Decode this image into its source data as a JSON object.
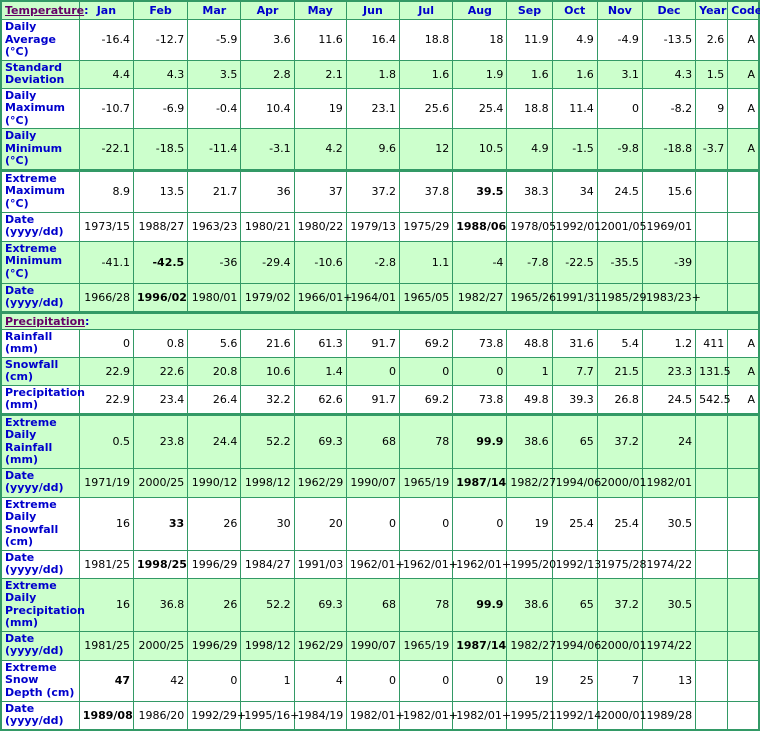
{
  "header": {
    "section_label": "Temperature",
    "months": [
      "Jan",
      "Feb",
      "Mar",
      "Apr",
      "May",
      "Jun",
      "Jul",
      "Aug",
      "Sep",
      "Oct",
      "Nov",
      "Dec"
    ],
    "year_label": "Year",
    "code_label": "Code"
  },
  "temperature": [
    {
      "label": "Daily Average (°C)",
      "values": [
        "-16.4",
        "-12.7",
        "-5.9",
        "3.6",
        "11.6",
        "16.4",
        "18.8",
        "18",
        "11.9",
        "4.9",
        "-4.9",
        "-13.5"
      ],
      "year": "2.6",
      "code": "A",
      "bold_index": -1
    },
    {
      "label": "Standard Deviation",
      "values": [
        "4.4",
        "4.3",
        "3.5",
        "2.8",
        "2.1",
        "1.8",
        "1.6",
        "1.9",
        "1.6",
        "1.6",
        "3.1",
        "4.3"
      ],
      "year": "1.5",
      "code": "A",
      "bold_index": -1
    },
    {
      "label": "Daily Maximum (°C)",
      "values": [
        "-10.7",
        "-6.9",
        "-0.4",
        "10.4",
        "19",
        "23.1",
        "25.6",
        "25.4",
        "18.8",
        "11.4",
        "0",
        "-8.2"
      ],
      "year": "9",
      "code": "A",
      "bold_index": -1
    },
    {
      "label": "Daily Minimum (°C)",
      "values": [
        "-22.1",
        "-18.5",
        "-11.4",
        "-3.1",
        "4.2",
        "9.6",
        "12",
        "10.5",
        "4.9",
        "-1.5",
        "-9.8",
        "-18.8"
      ],
      "year": "-3.7",
      "code": "A",
      "bold_index": -1
    },
    {
      "label": "Extreme Maximum (°C)",
      "values": [
        "8.9",
        "13.5",
        "21.7",
        "36",
        "37",
        "37.2",
        "37.8",
        "39.5",
        "38.3",
        "34",
        "24.5",
        "15.6"
      ],
      "year": "",
      "code": "",
      "bold_index": 7
    },
    {
      "label": "Date (yyyy/dd)",
      "values": [
        "1973/15",
        "1988/27",
        "1963/23",
        "1980/21",
        "1980/22",
        "1979/13",
        "1975/29",
        "1988/06",
        "1978/05",
        "1992/01",
        "2001/05",
        "1969/01"
      ],
      "year": "",
      "code": "",
      "bold_index": 7
    },
    {
      "label": "Extreme Minimum (°C)",
      "values": [
        "-41.1",
        "-42.5",
        "-36",
        "-29.4",
        "-10.6",
        "-2.8",
        "1.1",
        "-4",
        "-7.8",
        "-22.5",
        "-35.5",
        "-39"
      ],
      "year": "",
      "code": "",
      "bold_index": 1
    },
    {
      "label": "Date (yyyy/dd)",
      "values": [
        "1966/28",
        "1996/02",
        "1980/01",
        "1979/02",
        "1966/01+",
        "1964/01",
        "1965/05",
        "1982/27",
        "1965/26",
        "1991/31",
        "1985/29",
        "1983/23+"
      ],
      "year": "",
      "code": "",
      "bold_index": 1
    }
  ],
  "precipitation_section_label": "Precipitation",
  "precipitation": [
    {
      "label": "Rainfall (mm)",
      "values": [
        "0",
        "0.8",
        "5.6",
        "21.6",
        "61.3",
        "91.7",
        "69.2",
        "73.8",
        "48.8",
        "31.6",
        "5.4",
        "1.2"
      ],
      "year": "411",
      "code": "A",
      "bold_index": -1
    },
    {
      "label": "Snowfall (cm)",
      "values": [
        "22.9",
        "22.6",
        "20.8",
        "10.6",
        "1.4",
        "0",
        "0",
        "0",
        "1",
        "7.7",
        "21.5",
        "23.3"
      ],
      "year": "131.5",
      "code": "A",
      "bold_index": -1
    },
    {
      "label": "Precipitation (mm)",
      "values": [
        "22.9",
        "23.4",
        "26.4",
        "32.2",
        "62.6",
        "91.7",
        "69.2",
        "73.8",
        "49.8",
        "39.3",
        "26.8",
        "24.5"
      ],
      "year": "542.5",
      "code": "A",
      "bold_index": -1
    },
    {
      "label": "Extreme Daily Rainfall (mm)",
      "values": [
        "0.5",
        "23.8",
        "24.4",
        "52.2",
        "69.3",
        "68",
        "78",
        "99.9",
        "38.6",
        "65",
        "37.2",
        "24"
      ],
      "year": "",
      "code": "",
      "bold_index": 7
    },
    {
      "label": "Date (yyyy/dd)",
      "values": [
        "1971/19",
        "2000/25",
        "1990/12",
        "1998/12",
        "1962/29",
        "1990/07",
        "1965/19",
        "1987/14",
        "1982/27",
        "1994/06",
        "2000/01",
        "1982/01"
      ],
      "year": "",
      "code": "",
      "bold_index": 7
    },
    {
      "label": "Extreme Daily Snowfall (cm)",
      "values": [
        "16",
        "33",
        "26",
        "30",
        "20",
        "0",
        "0",
        "0",
        "19",
        "25.4",
        "25.4",
        "30.5"
      ],
      "year": "",
      "code": "",
      "bold_index": 1
    },
    {
      "label": "Date (yyyy/dd)",
      "values": [
        "1981/25",
        "1998/25",
        "1996/29",
        "1984/27",
        "1991/03",
        "1962/01+",
        "1962/01+",
        "1962/01+",
        "1995/20",
        "1992/13",
        "1975/28",
        "1974/22"
      ],
      "year": "",
      "code": "",
      "bold_index": 1
    },
    {
      "label": "Extreme Daily Precipitation (mm)",
      "values": [
        "16",
        "36.8",
        "26",
        "52.2",
        "69.3",
        "68",
        "78",
        "99.9",
        "38.6",
        "65",
        "37.2",
        "30.5"
      ],
      "year": "",
      "code": "",
      "bold_index": 7
    },
    {
      "label": "Date (yyyy/dd)",
      "values": [
        "1981/25",
        "2000/25",
        "1996/29",
        "1998/12",
        "1962/29",
        "1990/07",
        "1965/19",
        "1987/14",
        "1982/27",
        "1994/06",
        "2000/01",
        "1974/22"
      ],
      "year": "",
      "code": "",
      "bold_index": 7
    },
    {
      "label": "Extreme Snow Depth (cm)",
      "values": [
        "47",
        "42",
        "0",
        "1",
        "4",
        "0",
        "0",
        "0",
        "19",
        "25",
        "7",
        "13"
      ],
      "year": "",
      "code": "",
      "bold_index": 0
    },
    {
      "label": "Date (yyyy/dd)",
      "values": [
        "1989/08",
        "1986/20",
        "1992/29+",
        "1995/16+",
        "1984/19",
        "1982/01+",
        "1982/01+",
        "1982/01+",
        "1995/21",
        "1992/14",
        "2000/01",
        "1989/28"
      ],
      "year": "",
      "code": "",
      "bold_index": 0
    }
  ],
  "colors": {
    "border": "#339966",
    "row_green": "#ccffcc",
    "row_white": "#ffffff",
    "label_blue": "#0000cc",
    "section_link": "#660066"
  }
}
